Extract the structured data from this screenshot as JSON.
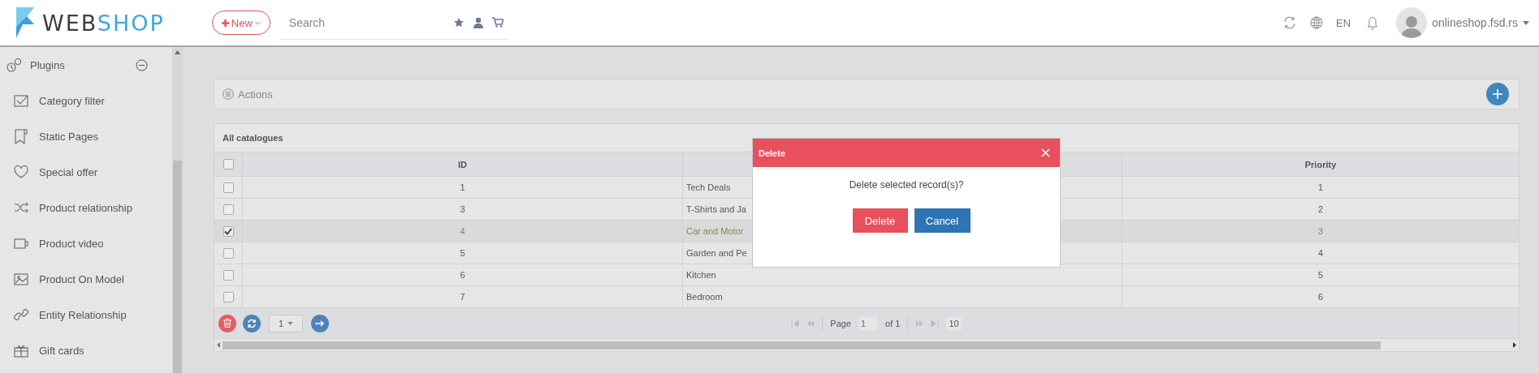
{
  "header": {
    "logo": {
      "parts": [
        "WEB",
        "SHOP"
      ]
    },
    "new_button": {
      "label": "New"
    },
    "search": {
      "placeholder": "Search"
    },
    "language": "EN",
    "user": {
      "name": "onlineshop.fsd.rs"
    }
  },
  "sidebar": {
    "group": {
      "label": "Plugins",
      "expanded": true
    },
    "items": [
      {
        "label": "Category filter"
      },
      {
        "label": "Static Pages"
      },
      {
        "label": "Special offer"
      },
      {
        "label": "Product relationship"
      },
      {
        "label": "Product video"
      },
      {
        "label": "Product On Model"
      },
      {
        "label": "Entity Relationship"
      },
      {
        "label": "Gift cards"
      }
    ]
  },
  "actions": {
    "label": "Actions"
  },
  "table": {
    "title": "All catalogues",
    "select_all": {
      "checked": false
    },
    "columns": [
      "ID",
      "Priority"
    ],
    "rows": [
      {
        "id": "1",
        "name": "Tech Deals",
        "priority": "1",
        "selected": false
      },
      {
        "id": "3",
        "name": "T-Shirts and Ja",
        "priority": "2",
        "selected": false
      },
      {
        "id": "4",
        "name": "Car and Motor",
        "priority": "3",
        "selected": true
      },
      {
        "id": "5",
        "name": "Garden and Pe",
        "priority": "4",
        "selected": false
      },
      {
        "id": "6",
        "name": "Kitchen",
        "priority": "5",
        "selected": false
      },
      {
        "id": "7",
        "name": "Bedroom",
        "priority": "6",
        "selected": false
      }
    ],
    "footer": {
      "page_size": "1",
      "page_label": "Page",
      "page": "1",
      "of_label": "of 1",
      "count": "10"
    }
  },
  "dialog": {
    "title": "Delete",
    "message": "Delete selected record(s)?",
    "buttons": [
      {
        "label": "Delete",
        "kind": "danger"
      },
      {
        "label": "Cancel",
        "kind": "primary"
      }
    ]
  }
}
